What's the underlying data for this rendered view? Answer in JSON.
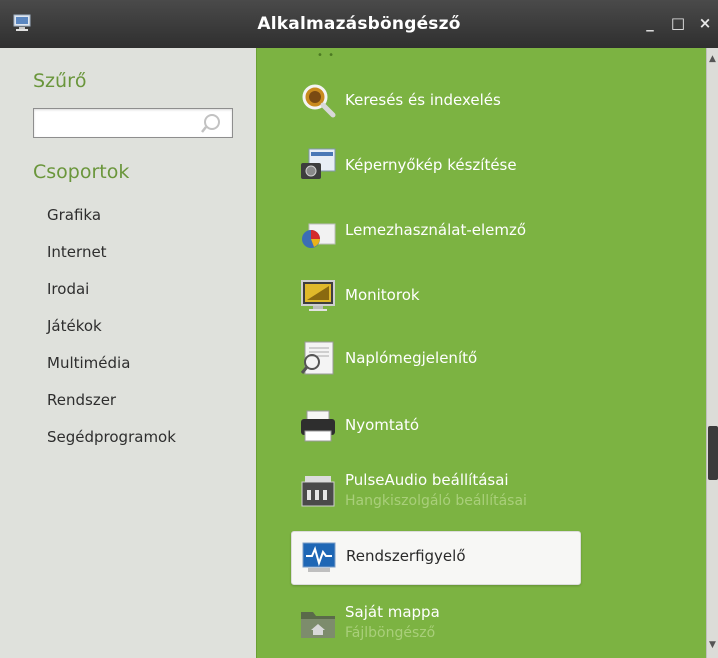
{
  "window": {
    "title": "Alkalmazásböngésző",
    "app_icon": "computer-icon",
    "controls": {
      "minimize": "_",
      "maximize": "□",
      "close": "×"
    }
  },
  "sidebar": {
    "filter_label": "Szűrő",
    "search": {
      "value": "",
      "placeholder": "",
      "icon": "search-icon"
    },
    "groups_label": "Csoportok",
    "groups": [
      "Grafika",
      "Internet",
      "Irodai",
      "Játékok",
      "Multimédia",
      "Rendszer",
      "Segédprogramok"
    ]
  },
  "apps": [
    {
      "name": "Keresés és indexelés",
      "icon": "search-index-icon"
    },
    {
      "name": "Képernyőkép készítése",
      "icon": "screenshot-icon"
    },
    {
      "name": "Lemezhasználat-elemző",
      "icon": "disk-usage-icon"
    },
    {
      "name": "Monitorok",
      "icon": "monitor-icon"
    },
    {
      "name": "Naplómegjelenítő",
      "icon": "log-viewer-icon"
    },
    {
      "name": "Nyomtató",
      "icon": "printer-icon"
    },
    {
      "name": "PulseAudio beállításai",
      "description": "Hangkiszolgáló beállításai",
      "icon": "audio-settings-icon"
    },
    {
      "name": "Rendszerfigyelő",
      "icon": "system-monitor-icon",
      "selected": true
    },
    {
      "name": "Saját mappa",
      "description": "Fájlböngésző",
      "icon": "home-folder-icon"
    }
  ],
  "colors": {
    "accent": "#7cb342",
    "heading": "#6a963b",
    "titlebar": "#3a3a3a"
  }
}
